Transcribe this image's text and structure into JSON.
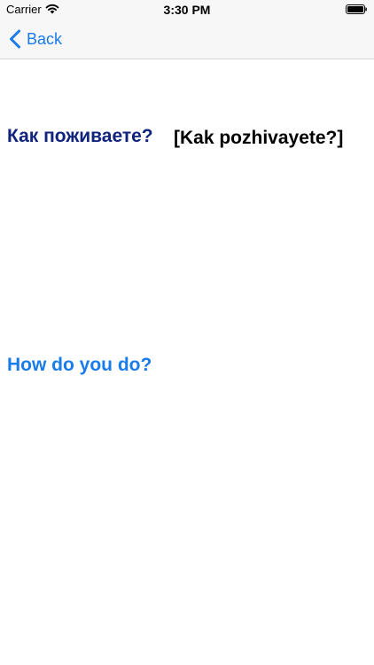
{
  "status_bar": {
    "carrier": "Carrier",
    "time": "3:30 PM",
    "icons": [
      "wifi-icon",
      "battery-icon"
    ]
  },
  "nav": {
    "back_label": "Back",
    "back_icon": "chevron-left-icon"
  },
  "phrase": {
    "native": "Как поживаете?",
    "transliteration": "[Kak pozhivayete?]",
    "translation": "How do you do?"
  },
  "colors": {
    "accent": "#1a7bea",
    "native_text": "#10237d",
    "transliteration_text": "#000000",
    "bar_background": "#f7f7f7"
  }
}
